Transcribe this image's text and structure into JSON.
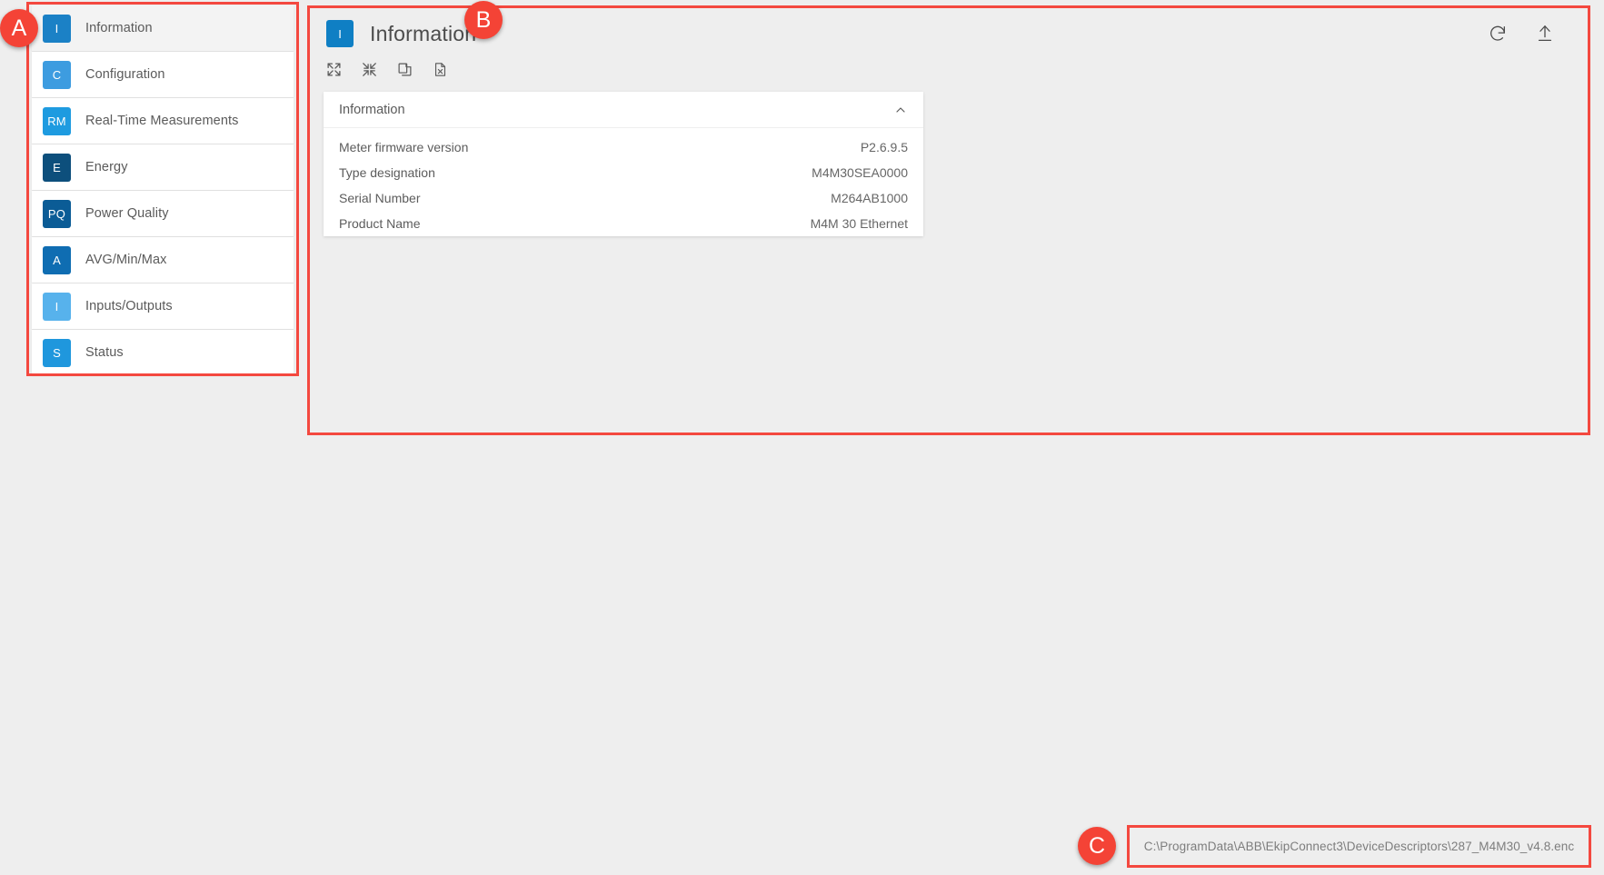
{
  "annotations": [
    {
      "id": "A",
      "label": "A",
      "target": "sidebar-navigation"
    },
    {
      "id": "B",
      "label": "B",
      "target": "main-content-panel"
    },
    {
      "id": "C",
      "label": "C",
      "target": "status-bar-path"
    }
  ],
  "colors": {
    "annotation_red": "#f44336",
    "page_background": "#eeeeee",
    "card_background": "#ffffff",
    "accent_blue": "#0f7fc4",
    "text_primary": "#4c4c4c",
    "text_secondary": "#5a5a5a"
  },
  "sidebar": {
    "items": [
      {
        "badge": "I",
        "label": "Information",
        "badge_color": "#1b81c6",
        "active": true
      },
      {
        "badge": "C",
        "label": "Configuration",
        "badge_color": "#3d9ce0",
        "active": false
      },
      {
        "badge": "RM",
        "label": "Real-Time Measurements",
        "badge_color": "#1e9be0",
        "active": false
      },
      {
        "badge": "E",
        "label": "Energy",
        "badge_color": "#0d4f7c",
        "active": false
      },
      {
        "badge": "PQ",
        "label": "Power Quality",
        "badge_color": "#0b5c96",
        "active": false
      },
      {
        "badge": "A",
        "label": "AVG/Min/Max",
        "badge_color": "#0f6db2",
        "active": false
      },
      {
        "badge": "I",
        "label": "Inputs/Outputs",
        "badge_color": "#57b2ec",
        "active": false
      },
      {
        "badge": "S",
        "label": "Status",
        "badge_color": "#1f97dd",
        "active": false
      }
    ]
  },
  "main": {
    "page_icon_letter": "I",
    "title": "Information",
    "header_actions": [
      {
        "name": "refresh-icon",
        "tooltip": "Refresh"
      },
      {
        "name": "upload-icon",
        "tooltip": "Upload"
      }
    ],
    "toolbar": [
      {
        "name": "expand-all-icon",
        "tooltip": "Expand all"
      },
      {
        "name": "collapse-all-icon",
        "tooltip": "Collapse all"
      },
      {
        "name": "copy-icon",
        "tooltip": "Copy"
      },
      {
        "name": "export-excel-icon",
        "tooltip": "Export to Excel"
      }
    ],
    "card": {
      "title": "Information",
      "expanded": true,
      "chevron": "chevron-up-icon",
      "rows": [
        {
          "label": "Meter firmware version",
          "value": "P2.6.9.5"
        },
        {
          "label": "Type designation",
          "value": "M4M30SEA0000"
        },
        {
          "label": "Serial Number",
          "value": "M264AB1000"
        },
        {
          "label": "Product Name",
          "value": "M4M 30 Ethernet"
        }
      ]
    }
  },
  "status_bar": {
    "path": "C:\\ProgramData\\ABB\\EkipConnect3\\DeviceDescriptors\\287_M4M30_v4.8.enc"
  }
}
